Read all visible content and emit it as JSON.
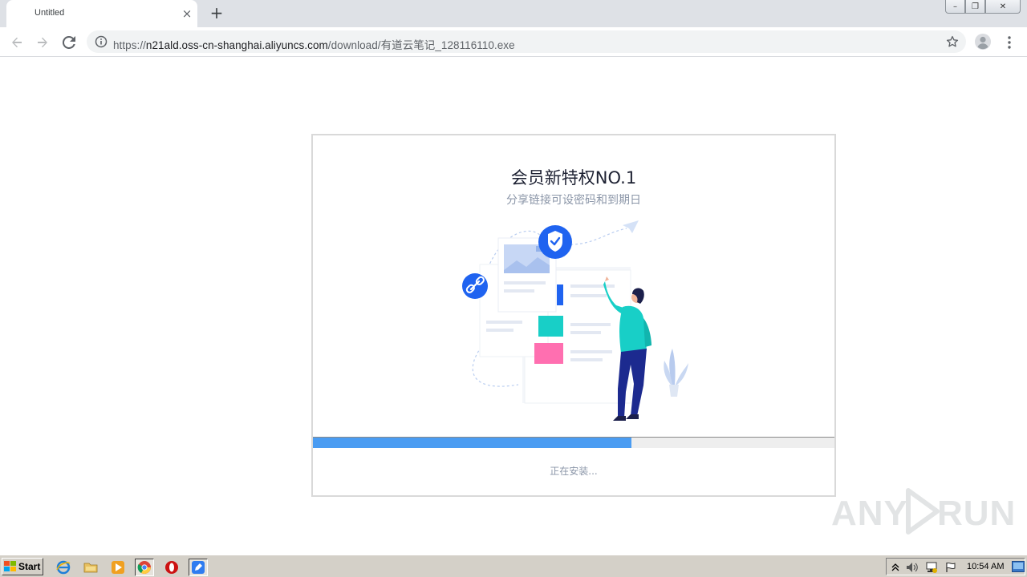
{
  "browser": {
    "tab": {
      "title": "Untitled",
      "close_glyph": "×"
    },
    "new_tab_glyph": "+",
    "url": {
      "scheme": "https://",
      "host": "n21ald.oss-cn-shanghai.aliyuncs.com",
      "path": "/download/有道云笔记_128116110.exe"
    },
    "window_buttons": {
      "minimize": "–",
      "restore": "❐",
      "close": "✕"
    }
  },
  "installer": {
    "title": "会员新特权NO.1",
    "subtitle": "分享链接可设密码和到期日",
    "progress": 0.61,
    "status": "正在安装..."
  },
  "watermark": {
    "left": "ANY",
    "right": "RUN"
  },
  "taskbar": {
    "start_label": "Start",
    "clock": "10:54 AM",
    "quick_launch": [
      "ie-icon",
      "explorer-folder-icon",
      "media-player-icon",
      "chrome-icon",
      "opera-icon",
      "installer-app-icon"
    ],
    "tray": [
      "tray-expand-icon",
      "volume-icon",
      "network-icon",
      "action-center-flag-icon"
    ]
  },
  "colors": {
    "accent": "#4a9cf2",
    "title_text": "#1e2233",
    "muted_text": "#8b96a8"
  }
}
